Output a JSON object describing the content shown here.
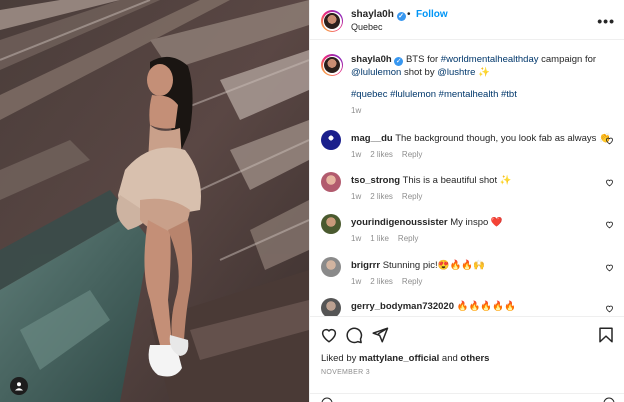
{
  "post": {
    "username": "shayla0h",
    "verified_mark": "✓",
    "dot": "•",
    "follow_label": "Follow",
    "location": "Quebec",
    "more_label": "•••"
  },
  "caption": {
    "username": "shayla0h",
    "text_before": "BTS for ",
    "tag1": "#worldmentalhealthday",
    "text_mid": " campaign for ",
    "mention1": "@lululemon",
    "text_mid2": " shot by ",
    "mention2": "@lushtre",
    "emoji": "✨",
    "hashtags": "#quebec #lululemon #mentalhealth #tbt",
    "time": "1w"
  },
  "comments": [
    {
      "username": "mag__du",
      "text": "The background though, you look fab as always 👏",
      "time": "1w",
      "likes": "2 likes",
      "reply": "Reply",
      "avatar_color": "#1a1f8c"
    },
    {
      "username": "tso_strong",
      "text": "This is a beautiful shot ✨",
      "time": "1w",
      "likes": "2 likes",
      "reply": "Reply",
      "avatar_color": "#b25b6e"
    },
    {
      "username": "yourindigenoussister",
      "text": "My inspo ❤️",
      "time": "1w",
      "likes": "1 like",
      "reply": "Reply",
      "avatar_color": "#7a5a3a"
    },
    {
      "username": "brigrrr",
      "text": "Stunning pic!😍🔥🔥🙌",
      "time": "1w",
      "likes": "2 likes",
      "reply": "Reply",
      "avatar_color": "#8a8a8a"
    },
    {
      "username": "gerry_bodyman732020",
      "text": "🔥🔥🔥🔥🔥",
      "time": "",
      "likes": "",
      "reply": "",
      "avatar_color": "#555555"
    }
  ],
  "footer": {
    "liked_by_prefix": "Liked by ",
    "liked_by_user": "mattylane_official",
    "liked_by_and": " and ",
    "liked_by_others": "others",
    "date": "NOVEMBER 3"
  },
  "colors": {
    "link": "#00376b",
    "follow": "#0095f6",
    "meta_gray": "#8e8e8e",
    "heart_red": "#ed4956"
  }
}
